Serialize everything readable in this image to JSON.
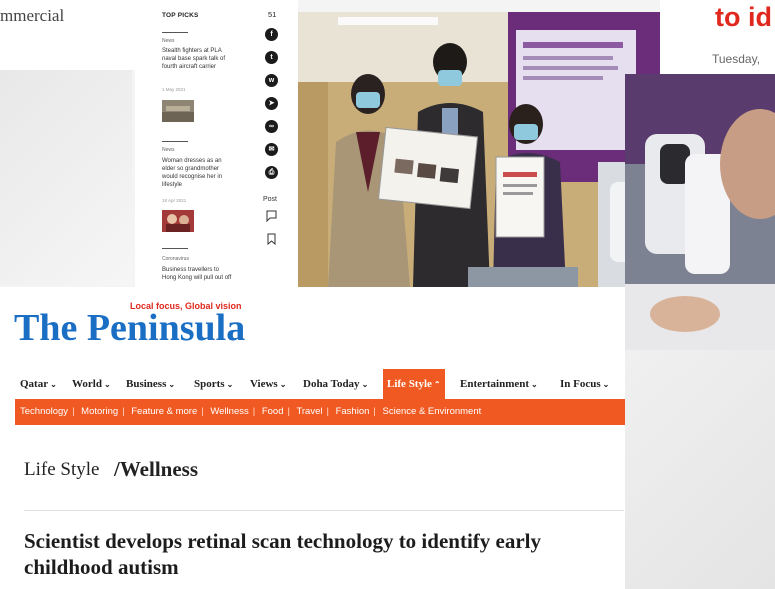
{
  "top_left": {
    "text": "mmercial"
  },
  "sidebar": {
    "heading": "TOP PICKS",
    "items": [
      {
        "tag": "News",
        "title": "Stealth fighters at PLA naval base spark talk of fourth aircraft carrier",
        "date": "1 May 2021"
      },
      {
        "tag": "News",
        "title": "Woman dresses as an elder so grandmother would recognise her in lifestyle",
        "date": "18 Apr 2021"
      },
      {
        "tag": "Coronavirus",
        "title": "Business travellers to Hong Kong will pull out off"
      }
    ],
    "share_count": "51",
    "share_icons": [
      "facebook-icon",
      "twitter-icon",
      "whatsapp-icon",
      "telegram-icon",
      "link-icon",
      "email-icon",
      "print-icon"
    ],
    "post_label": "Post",
    "tool_icons": [
      "comment-icon",
      "bookmark-icon"
    ]
  },
  "right_fragment": {
    "title": "to id",
    "date": "Tuesday,"
  },
  "peninsula": {
    "logo_text": "The Peninsula",
    "tagline": "Local focus, Global vision",
    "nav": [
      {
        "label": "Qatar",
        "chevron": "down"
      },
      {
        "label": "World",
        "chevron": "down"
      },
      {
        "label": "Business",
        "chevron": "down"
      },
      {
        "label": "Sports",
        "chevron": "down"
      },
      {
        "label": "Views",
        "chevron": "down"
      },
      {
        "label": "Doha Today",
        "chevron": "down"
      },
      {
        "label": "Life Style",
        "chevron": "up",
        "active": true
      },
      {
        "label": "Entertainment",
        "chevron": "down"
      },
      {
        "label": "In Focus",
        "chevron": "down"
      }
    ],
    "subnav": [
      "Technology",
      "Motoring",
      "Feature & more",
      "Wellness",
      "Food",
      "Travel",
      "Fashion",
      "Science & Environment"
    ],
    "breadcrumb": {
      "parent": "Life Style",
      "separator": "/",
      "current": "Wellness"
    },
    "headline": "Scientist develops retinal scan technology to identify early childhood autism"
  },
  "colors": {
    "accent": "#f05a22",
    "brand_blue": "#1a6fc4",
    "red": "#e0281e"
  }
}
